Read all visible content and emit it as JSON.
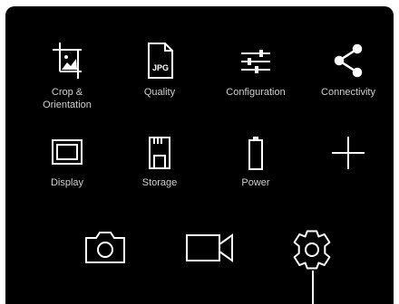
{
  "menu": {
    "items": [
      {
        "label": "Crop &\nOrientation",
        "icon": "crop-icon"
      },
      {
        "label": "Quality",
        "icon": "jpg-file-icon",
        "badge": "JPG"
      },
      {
        "label": "Configuration",
        "icon": "sliders-icon"
      },
      {
        "label": "Connectivity",
        "icon": "share-icon"
      },
      {
        "label": "Display",
        "icon": "display-icon"
      },
      {
        "label": "Storage",
        "icon": "storage-icon"
      },
      {
        "label": "Power",
        "icon": "battery-icon"
      },
      {
        "label": "",
        "icon": "plus-icon"
      }
    ]
  },
  "modes": [
    {
      "icon": "camera-icon"
    },
    {
      "icon": "video-icon"
    },
    {
      "icon": "settings-gear-icon"
    }
  ],
  "colors": {
    "background": "#000000",
    "icon": "#ffffff",
    "label": "#cfcfcf"
  }
}
